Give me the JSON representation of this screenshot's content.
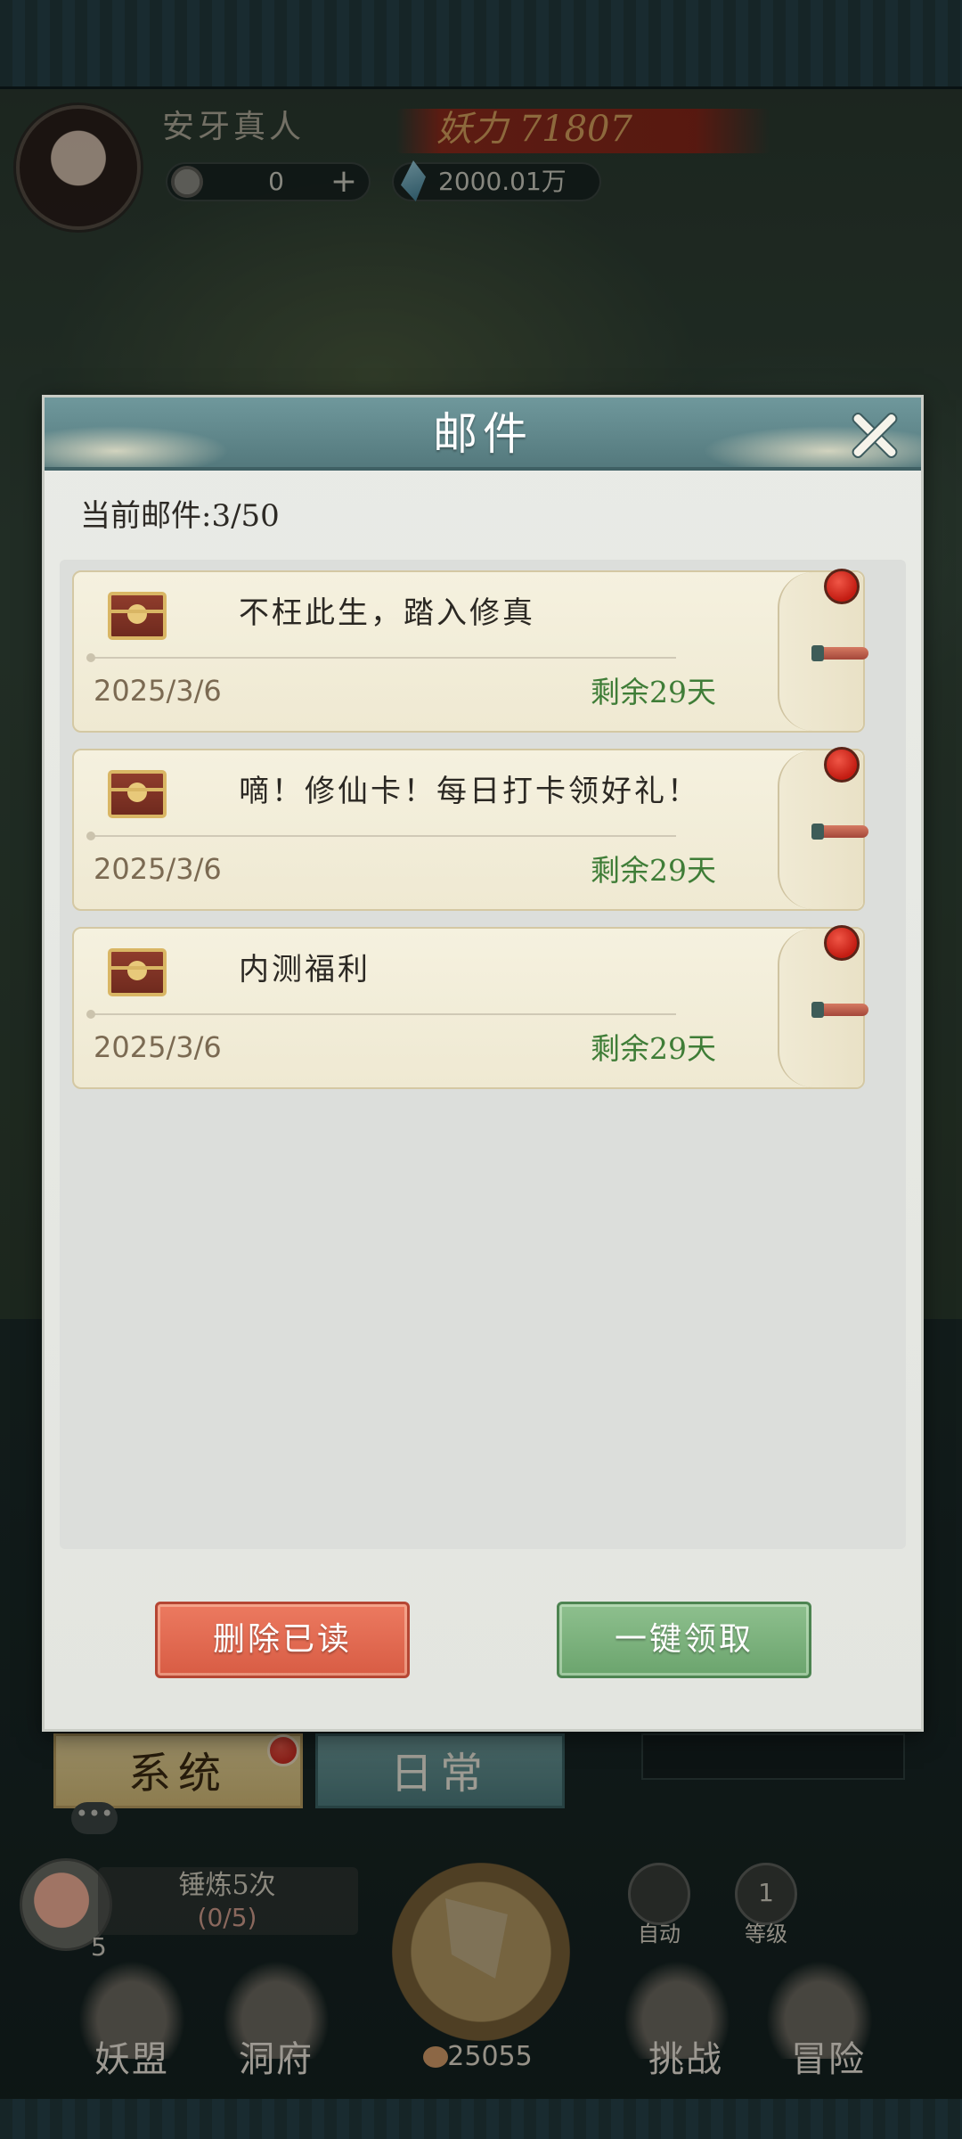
{
  "player": {
    "name": "安牙真人",
    "power": "妖力 71807",
    "coins": "0",
    "gems": "2000.01万"
  },
  "mail_dialog": {
    "title": "邮件",
    "count_label": "当前邮件:3/50",
    "mails": [
      {
        "subject": "不枉此生，踏入修真",
        "date": "2025/3/6",
        "remaining": "剩余29天",
        "unread": true
      },
      {
        "subject": "嘀！修仙卡！每日打卡领好礼！",
        "date": "2025/3/6",
        "remaining": "剩余29天",
        "unread": true
      },
      {
        "subject": "内测福利",
        "date": "2025/3/6",
        "remaining": "剩余29天",
        "unread": true
      }
    ],
    "delete_read_label": "删除已读",
    "claim_all_label": "一键领取"
  },
  "tabs": {
    "system": "系统",
    "daily": "日常"
  },
  "chat": {
    "icon_text": "•••"
  },
  "bottom": {
    "peach_count": "5",
    "forge_title": "锤炼5次",
    "forge_progress": "(0/5)",
    "auto_label": "自动",
    "level_value": "1",
    "level_label": "等级",
    "food_count": "25055",
    "nav": {
      "alliance": "妖盟",
      "cave": "洞府",
      "challenge": "挑战",
      "adventure": "冒险"
    }
  },
  "colors": {
    "remaining_text": "#3f7d37",
    "date_text": "#7b6a52",
    "unread_dot": "#c31c12",
    "delete_button": "#d85c44",
    "claim_button": "#6ba46d",
    "header_bar": "#54797d"
  }
}
